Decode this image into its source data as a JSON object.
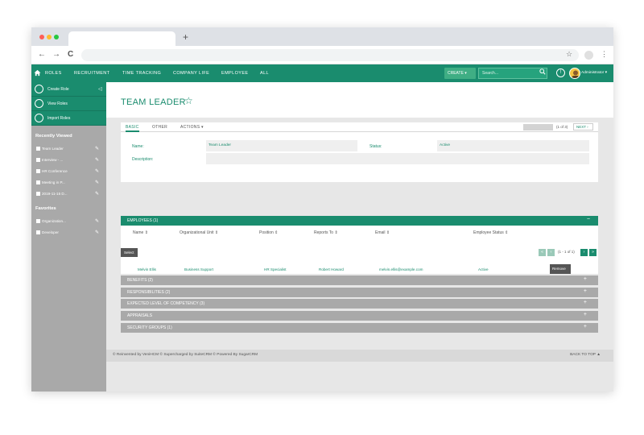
{
  "browser": {
    "new_tab": "+",
    "back": "←",
    "forward": "→",
    "reload": "C",
    "star": "☆",
    "menu": "⋮"
  },
  "topnav": {
    "home_icon": "home-icon",
    "items": [
      "ROLES",
      "RECRUITMENT",
      "TIME TRACKING",
      "COMPANY LIFE",
      "EMPLOYEE",
      "ALL"
    ],
    "create_label": "CREATE ▾",
    "search_placeholder": "Search...",
    "user_label": "Administrator ▾",
    "accent": "#1a8c6e"
  },
  "sidebar": {
    "actions": [
      {
        "label": "Create Role",
        "icon": "plus-icon"
      },
      {
        "label": "View Roles",
        "icon": "eye-icon"
      },
      {
        "label": "Import Roles",
        "icon": "import-icon"
      }
    ],
    "collapse": "◁",
    "recently_viewed_heading": "Recently Viewed",
    "recently_viewed": [
      {
        "label": "Team Leader",
        "icon": "users-icon"
      },
      {
        "label": "Interview - ...",
        "icon": "calendar-icon"
      },
      {
        "label": "HR Conference",
        "icon": "event-icon"
      },
      {
        "label": "Meeting in P...",
        "icon": "meeting-icon"
      },
      {
        "label": "2019-11-15 D...",
        "icon": "group-icon"
      }
    ],
    "favorites_heading": "Favorites",
    "favorites": [
      {
        "label": "Organization...",
        "icon": "list-icon"
      },
      {
        "label": "Developer",
        "icon": "document-icon"
      }
    ],
    "edit_glyph": "✎"
  },
  "main": {
    "title": "TEAM LEADER",
    "star": "☆",
    "tabs": [
      "BASIC",
      "OTHER",
      "ACTIONS ▾"
    ],
    "pager": "(1 of 3)",
    "next_label": "NEXT ›",
    "fields": {
      "name_label": "Name:",
      "name_value": "Team Leader",
      "status_label": "Status:",
      "status_value": "Active",
      "description_label": "Description:",
      "description_value": ""
    },
    "employees": {
      "header": "EMPLOYEES (1)",
      "toggle": "−",
      "columns": [
        "Name ⇕",
        "Organizational Unit ⇕",
        "Position ⇕",
        "Reports To ⇕",
        "Email ⇕",
        "Employee Status ⇕"
      ],
      "select_label": "Select",
      "pagination": "(1 - 1 of 1)",
      "pager_buttons": [
        "«",
        "‹",
        "›",
        "»"
      ],
      "rows": [
        {
          "name": "Melvin Ellis",
          "org_unit": "Business Support",
          "position": "HR Specialist",
          "reports_to": "Robert Howard",
          "email": "melvin.ellis@example.com",
          "status": "Active"
        }
      ],
      "remove_label": "Remove"
    },
    "subpanels": [
      {
        "label": "BENEFITS (2)",
        "icon": "umbrella-icon"
      },
      {
        "label": "RESPONSIBILITIES (2)",
        "icon": "list-icon"
      },
      {
        "label": "EXPECTED LEVEL OF COMPETENCY (3)",
        "icon": "star-icon"
      },
      {
        "label": "APPRAISALS",
        "icon": "appraisal-icon"
      },
      {
        "label": "SECURITY GROUPS (1)",
        "icon": "lock-icon"
      }
    ],
    "plus": "+",
    "footer": {
      "credits": "© Reinvented by VeniHCM   © Supercharged by SuiteCRM   © Powered By SugarCRM",
      "back_to_top": "BACK TO TOP ▲"
    }
  }
}
